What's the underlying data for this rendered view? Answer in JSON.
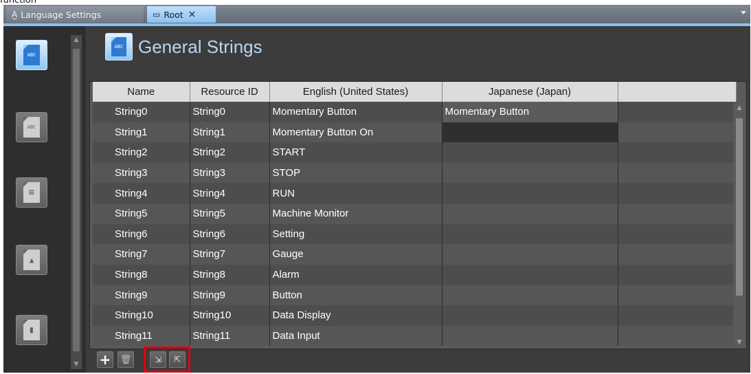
{
  "top_cut_text": "function",
  "tabs": [
    {
      "label": "Language Settings",
      "icon": "language-icon",
      "active": false
    },
    {
      "label": "Root",
      "icon": "page-icon",
      "active": true,
      "close": "×"
    }
  ],
  "sidebar": {
    "categories": [
      {
        "name": "general-strings",
        "icon": "abc-doc-icon",
        "glyph": "ABC",
        "selected": true
      },
      {
        "name": "voice-strings",
        "icon": "abc-speaker-icon",
        "glyph": "ABC",
        "selected": false
      },
      {
        "name": "list-strings",
        "icon": "list-doc-icon",
        "glyph": "≡",
        "selected": false
      },
      {
        "name": "shape-strings",
        "icon": "shapes-doc-icon",
        "glyph": "▲",
        "selected": false
      },
      {
        "name": "image-strings",
        "icon": "image-doc-icon",
        "glyph": "▮",
        "selected": false
      }
    ]
  },
  "header": {
    "title": "General Strings",
    "icon": "abc-doc-icon",
    "glyph": "ABC"
  },
  "table": {
    "columns": [
      "Name",
      "Resource ID",
      "English (United States)",
      "Japanese (Japan)",
      ""
    ],
    "rows": [
      [
        "String0",
        "String0",
        "Momentary Button",
        "Momentary Button",
        ""
      ],
      [
        "String1",
        "String1",
        "Momentary Button On",
        "",
        ""
      ],
      [
        "String2",
        "String2",
        "START",
        "",
        ""
      ],
      [
        "String3",
        "String3",
        "STOP",
        "",
        ""
      ],
      [
        "String4",
        "String4",
        "RUN",
        "",
        ""
      ],
      [
        "String5",
        "String5",
        "Machine Monitor",
        "",
        ""
      ],
      [
        "String6",
        "String6",
        "Setting",
        "",
        ""
      ],
      [
        "String7",
        "String7",
        "Gauge",
        "",
        ""
      ],
      [
        "String8",
        "String8",
        "Alarm",
        "",
        ""
      ],
      [
        "String9",
        "String9",
        "Button",
        "",
        ""
      ],
      [
        "String10",
        "String10",
        "Data Display",
        "",
        ""
      ],
      [
        "String11",
        "String11",
        "Data Input",
        "",
        ""
      ]
    ]
  },
  "toolbar": {
    "add": {
      "icon": "plus-icon",
      "glyph": "+"
    },
    "delete": {
      "icon": "trash-icon",
      "glyph": "🗑"
    },
    "import": {
      "icon": "import-icon",
      "glyph": "⇲"
    },
    "export": {
      "icon": "export-icon",
      "glyph": "⇱"
    },
    "highlight_color": "#e0000b"
  },
  "colors": {
    "accent": "#8cc1f0",
    "title": "#b8d5f0",
    "selected_icon": "#2e7ad1"
  }
}
